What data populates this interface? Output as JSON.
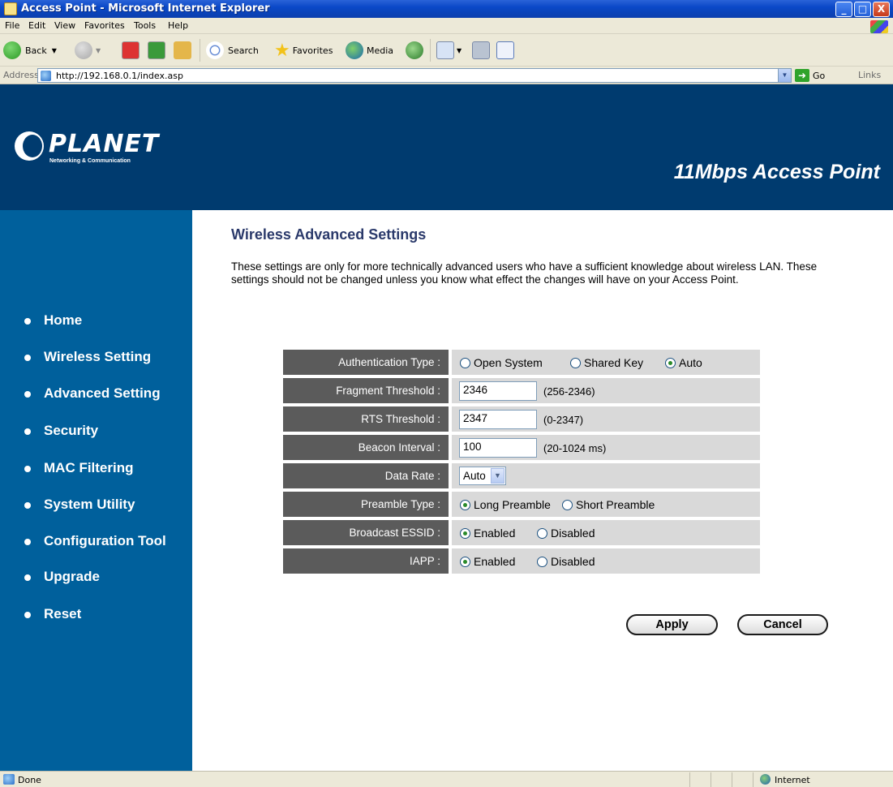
{
  "window": {
    "title": "Access Point - Microsoft Internet Explorer",
    "minimize": "_",
    "maximize": "□",
    "close": "X"
  },
  "menu": [
    "File",
    "Edit",
    "View",
    "Favorites",
    "Tools",
    "Help"
  ],
  "toolbar": {
    "back_label": "Back",
    "search_label": "Search",
    "favorites_label": "Favorites",
    "media_label": "Media"
  },
  "address": {
    "label": "Address",
    "url": "http://192.168.0.1/index.asp",
    "go_label": "Go",
    "links_label": "Links"
  },
  "header": {
    "brand": "PLANET",
    "tagline": "Networking & Communication",
    "product": "11Mbps Access Point"
  },
  "sidebar": {
    "items": [
      {
        "label": "Home"
      },
      {
        "label": "Wireless Setting"
      },
      {
        "label": "Advanced Setting"
      },
      {
        "label": "Security"
      },
      {
        "label": "MAC Filtering"
      },
      {
        "label": "System Utility"
      },
      {
        "label": "Configuration Tool"
      },
      {
        "label": "Upgrade"
      },
      {
        "label": "Reset"
      }
    ]
  },
  "main": {
    "title": "Wireless Advanced Settings",
    "description": "These settings are only for more technically advanced users who have a sufficient knowledge about wireless LAN. These settings should not be changed unless you know what effect the changes will have on your Access Point.",
    "fields": {
      "auth_type": {
        "label": "Authentication Type :",
        "options": [
          "Open System",
          "Shared Key",
          "Auto"
        ],
        "selected": "Auto"
      },
      "fragment": {
        "label": "Fragment Threshold :",
        "value": "2346",
        "range": "(256-2346)"
      },
      "rts": {
        "label": "RTS Threshold :",
        "value": "2347",
        "range": "(0-2347)"
      },
      "beacon": {
        "label": "Beacon Interval :",
        "value": "100",
        "range": "(20-1024 ms)"
      },
      "data_rate": {
        "label": "Data Rate :",
        "value": "Auto"
      },
      "preamble": {
        "label": "Preamble Type :",
        "options": [
          "Long Preamble",
          "Short Preamble"
        ],
        "selected": "Long Preamble"
      },
      "broadcast_essid": {
        "label": "Broadcast ESSID :",
        "options": [
          "Enabled",
          "Disabled"
        ],
        "selected": "Enabled"
      },
      "iapp": {
        "label": "IAPP :",
        "options": [
          "Enabled",
          "Disabled"
        ],
        "selected": "Enabled"
      }
    },
    "apply_label": "Apply",
    "cancel_label": "Cancel"
  },
  "status": {
    "text": "Done",
    "zone": "Internet"
  }
}
